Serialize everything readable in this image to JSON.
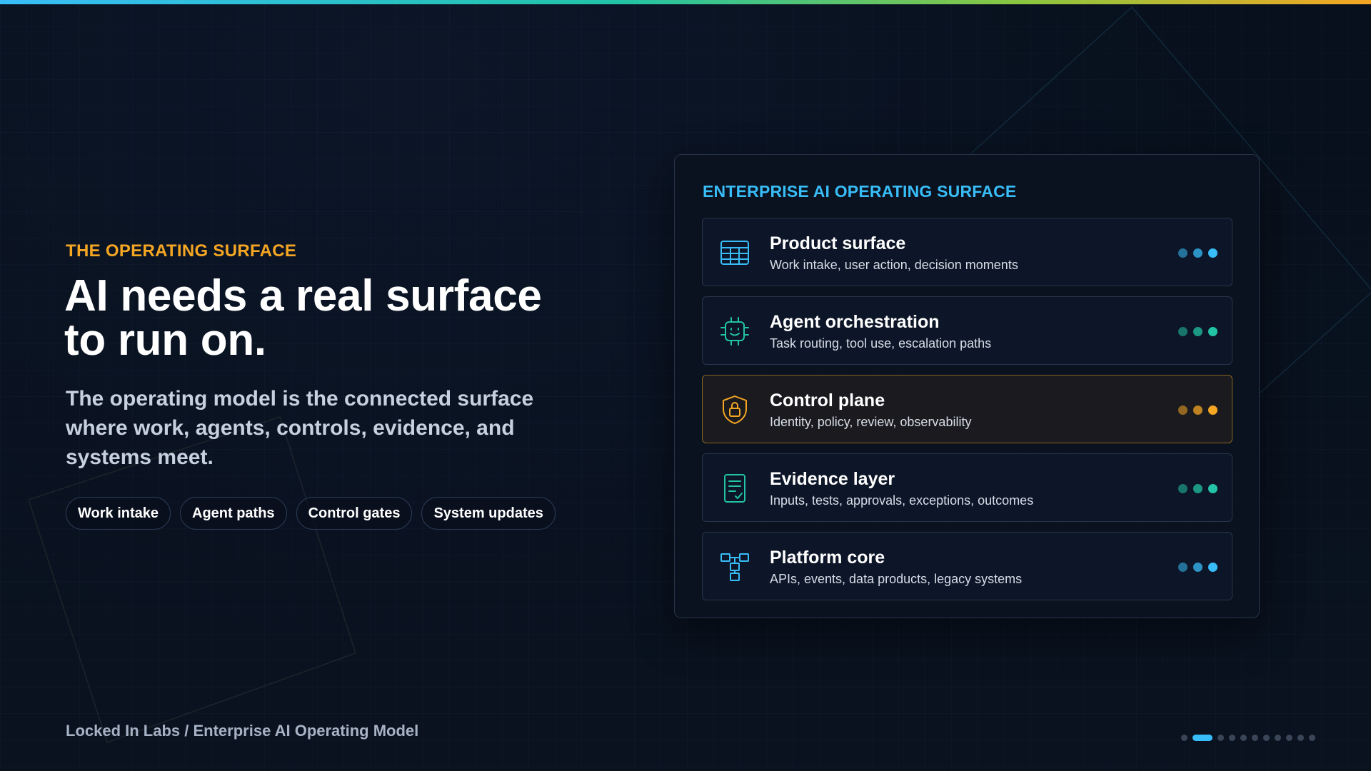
{
  "colors": {
    "accent_blue": "#38bdf8",
    "accent_orange": "#f5a623",
    "accent_green": "#22c3a6",
    "background": "#070d18"
  },
  "hero": {
    "eyebrow": "THE OPERATING SURFACE",
    "headline": "AI needs a real surface to run on.",
    "subtext": "The operating model is the connected surface where work, agents, controls, evidence, and systems meet.",
    "pills": [
      "Work intake",
      "Agent paths",
      "Control gates",
      "System updates"
    ]
  },
  "panel": {
    "title": "ENTERPRISE AI OPERATING SURFACE",
    "cards": [
      {
        "title": "Product surface",
        "desc": "Work intake, user action, decision moments",
        "icon": "table-grid-icon",
        "color": "#38bdf8"
      },
      {
        "title": "Agent orchestration",
        "desc": "Task routing, tool use, escalation paths",
        "icon": "robot-chip-icon",
        "color": "#22c3a6"
      },
      {
        "title": "Control plane",
        "desc": "Identity, policy, review, observability",
        "icon": "shield-lock-icon",
        "color": "#f5a623"
      },
      {
        "title": "Evidence layer",
        "desc": "Inputs, tests, approvals, exceptions, outcomes",
        "icon": "document-check-icon",
        "color": "#22c3a6"
      },
      {
        "title": "Platform core",
        "desc": "APIs, events, data products, legacy systems",
        "icon": "hierarchy-icon",
        "color": "#38bdf8"
      }
    ]
  },
  "footer": {
    "text": "Locked In Labs / Enterprise AI Operating Model"
  },
  "pager": {
    "total_slides": 11,
    "current_slide": 2
  }
}
